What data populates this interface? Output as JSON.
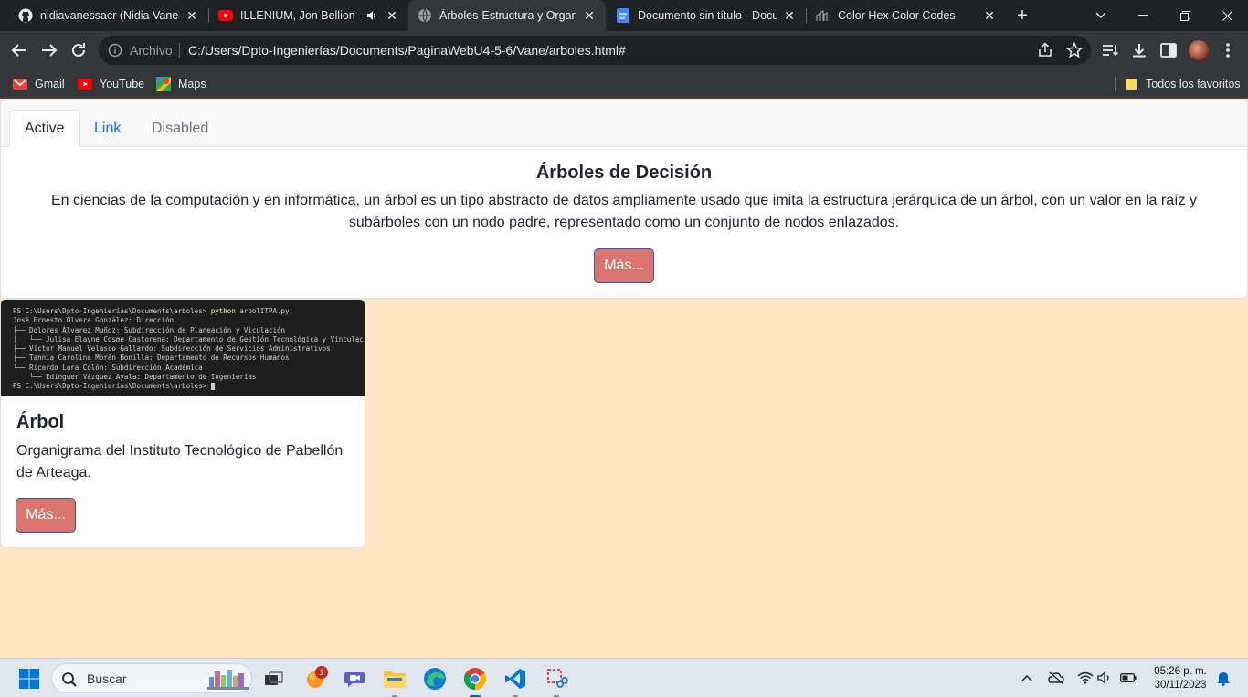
{
  "tabs": [
    {
      "title": "nidiavanessacr (Nidia Vanessa",
      "icon": "github-icon"
    },
    {
      "title": "ILLENIUM, Jon Bellion - G",
      "icon": "youtube-icon",
      "audio": true
    },
    {
      "title": "Árboles-Estructura y Organiz",
      "icon": "globe-icon",
      "active": true
    },
    {
      "title": "Documento sin título - Docu",
      "icon": "google-docs-icon"
    },
    {
      "title": "Color Hex Color Codes",
      "icon": "colorhex-icon"
    }
  ],
  "address": {
    "label": "Archivo",
    "url": "C:/Users/Dpto-Ingenierías/Documents/PaginaWebU4-5-6/Vane/arboles.html#"
  },
  "bookmarks": {
    "items": [
      {
        "label": "Gmail",
        "icon": "gmail-icon"
      },
      {
        "label": "YouTube",
        "icon": "youtube-icon"
      },
      {
        "label": "Maps",
        "icon": "maps-icon"
      }
    ],
    "all": "Todos los favoritos"
  },
  "page": {
    "nav_tabs": [
      "Active",
      "Link",
      "Disabled"
    ],
    "hero": {
      "title": "Árboles de Decisión",
      "text": "En ciencias de la computación y en informática, un árbol es un tipo abstracto de datos ampliamente usado que imita la estructura jerárquica de un árbol, con un valor en la raíz y subárboles con un nodo padre, representado como un conjunto de nodos enlazados.",
      "button": "Más..."
    },
    "card": {
      "terminal": {
        "prompt": "PS C:\\Users\\Dpto-Ingenierías\\Documents\\arboles>",
        "command": "python",
        "args": "arbolITPA.py",
        "lines": [
          "José Ernesto Olvera González: Dirección",
          "├── Dolores Álvarez Muñoz: Subdirección de Planeación y Viculación",
          "│   └── Julisa Elayne Cosme Castorena: Departamento de Gestión Tecnológica y Vinculación",
          "├── Víctor Manuel Velasco Gallardo: Subdirección de Servicios Administrativos",
          "├── Tannia Carolina Morán Bonilla: Departamento de Recursos Humanos",
          "└── Ricardo Lara Colón: Subdirección Académica",
          "    └── Edinguer Vázquez Ayala: Departamento de Ingenierías"
        ],
        "final_prompt": "PS C:\\Users\\Dpto-Ingenierías\\Documents\\arboles>"
      },
      "title": "Árbol",
      "text": "Organigrama del Instituto Tecnológico de Pabellón de Arteaga.",
      "button": "Más..."
    }
  },
  "taskbar": {
    "search_placeholder": "Buscar",
    "notification_count": "1",
    "time": "05:26 p. m.",
    "date": "30/11/2023"
  },
  "colors": {
    "page_bg": "#fde4c4",
    "button_bg": "#d9756e",
    "button_border": "#2d56b8",
    "link": "#0d6efd"
  }
}
